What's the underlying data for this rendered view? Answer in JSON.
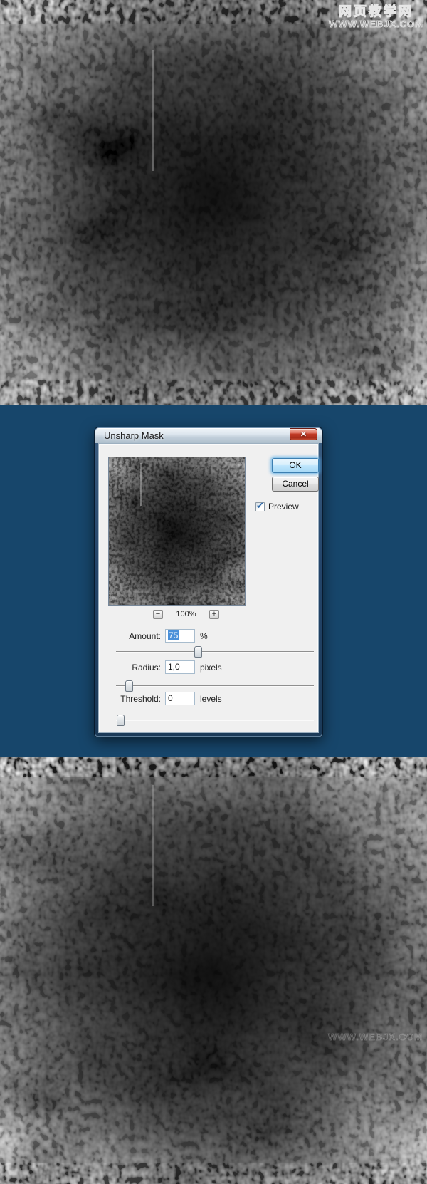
{
  "watermarks": {
    "top": {
      "title": "网页教学网",
      "url": "www.webjx.com"
    },
    "bottom": {
      "url": "www.webjx.com"
    }
  },
  "dialog": {
    "title": "Unsharp Mask",
    "close_glyph": "✕",
    "ok_label": "OK",
    "cancel_label": "Cancel",
    "preview": {
      "label": "Preview",
      "checked": true,
      "check_glyph": "✔"
    },
    "zoom": {
      "minus_glyph": "−",
      "level": "100%",
      "plus_glyph": "+"
    },
    "fields": [
      {
        "label": "Amount:",
        "value": "75",
        "unit": "%",
        "selected": true
      },
      {
        "label": "Radius:",
        "value": "1,0",
        "unit": "pixels",
        "selected": false
      },
      {
        "label": "Threshold:",
        "value": "0",
        "unit": "levels",
        "selected": false
      }
    ]
  },
  "colors": {
    "page_background": "#17466b",
    "dialog_client": "#f0f0f0",
    "selection_blue": "#4a90d9",
    "close_button_red": "#c23b27",
    "ok_focus_blue": "#3c7fb1"
  }
}
